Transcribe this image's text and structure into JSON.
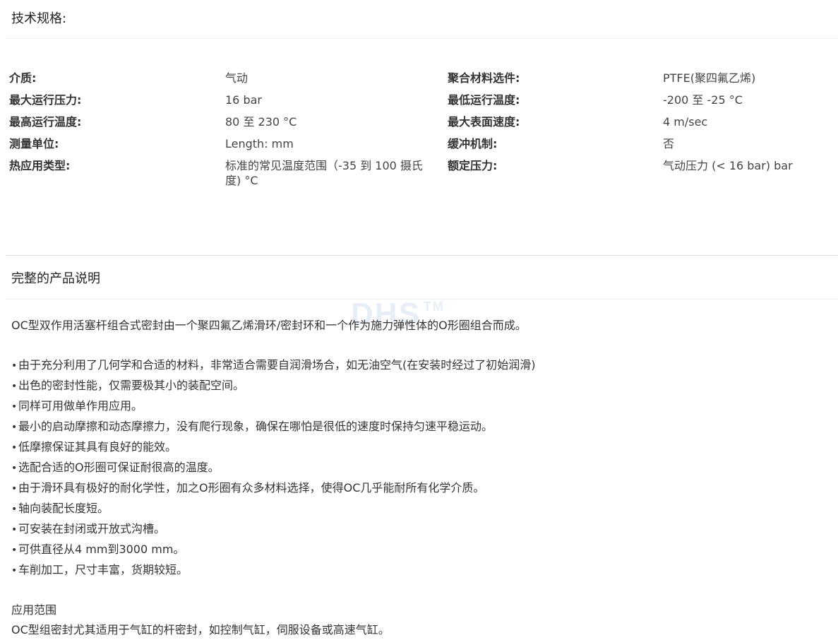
{
  "specs": {
    "title": "技术规格:",
    "rows": [
      {
        "label1": "介质:",
        "value1": "气动",
        "label2": "聚合材料选件:",
        "value2": "PTFE(聚四氟乙烯)"
      },
      {
        "label1": "最大运行压力:",
        "value1": "16 bar",
        "label2": "最低运行温度:",
        "value2": "-200 至 -25 °C"
      },
      {
        "label1": "最高运行温度:",
        "value1": "80 至 230 °C",
        "label2": "最大表面速度:",
        "value2": "4 m/sec"
      },
      {
        "label1": "测量单位:",
        "value1": "Length: mm",
        "label2": "缓冲机制:",
        "value2": "否"
      },
      {
        "label1": "热应用类型:",
        "value1": "标准的常见温度范围（-35 到 100 摄氏度) °C",
        "label2": "额定压力:",
        "value2": "气动压力 (< 16 bar) bar"
      }
    ]
  },
  "description": {
    "title": "完整的产品说明",
    "watermark": "DHS",
    "watermark_tm": "TM",
    "intro": "OC型双作用活塞杆组合式密封由一个聚四氟乙烯滑环/密封环和一个作为施力弹性体的O形圈组合而成。",
    "bullet_symbol": "•",
    "bullets": [
      "由于充分利用了几何学和合适的材料，非常适合需要自润滑场合，如无油空气(在安装时经过了初始润滑)",
      "出色的密封性能，仅需要极其小的装配空间。",
      "同样可用做单作用应用。",
      "最小的启动摩擦和动态摩擦力，没有爬行现象，确保在哪怕是很低的速度时保持匀速平稳运动。",
      "低摩擦保证其具有良好的能效。",
      "选配合适的O形圈可保证耐很高的温度。",
      "由于滑环具有极好的耐化学性，加之O形圈有众多材料选择，使得OC几乎能耐所有化学介质。",
      "轴向装配长度短。",
      "可安装在封闭或开放式沟槽。",
      "可供直径从4 mm到3000 mm。",
      "车削加工，尺寸丰富，货期较短。"
    ],
    "application_title": "应用范围",
    "application_text": "OC型组密封尤其适用于气缸的杆密封，如控制气缸，伺服设备或高速气缸。"
  }
}
